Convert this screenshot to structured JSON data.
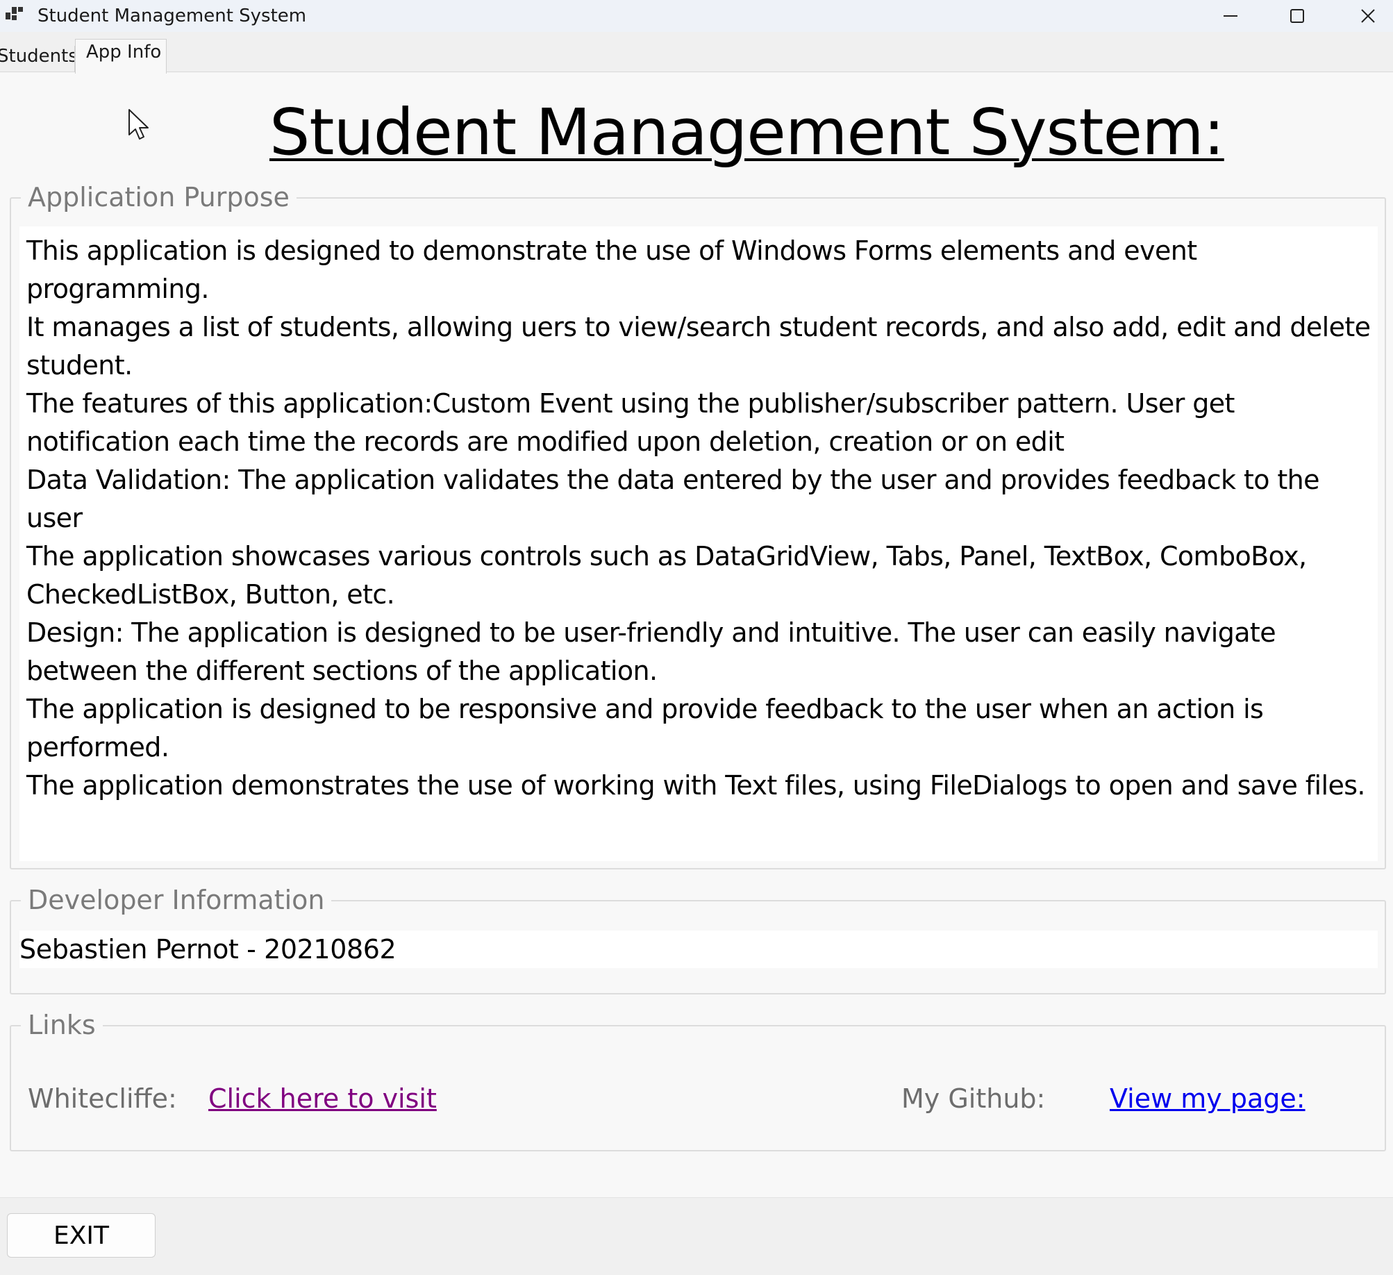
{
  "window": {
    "title": "Student Management System",
    "controls": {
      "minimize_icon": "minimize-icon",
      "maximize_icon": "maximize-icon",
      "close_icon": "close-icon"
    }
  },
  "tabs": [
    {
      "label": "Students",
      "selected": false
    },
    {
      "label": "App Info",
      "selected": true
    }
  ],
  "page": {
    "title": "Student Management System:"
  },
  "purpose": {
    "legend": "Application Purpose",
    "lines": [
      "This application is designed to demonstrate the use of Windows Forms elements and event",
      "programming.",
      "It manages a list of students, allowing uers to view/search student records, and also add, edit and delete",
      "student.",
      "The features of this application:Custom Event using the publisher/subscriber pattern. User get",
      "notification each time the records are modified upon deletion, creation or on edit",
      "Data Validation: The application validates the data entered by the user and provides feedback to the",
      "user",
      "The application showcases various controls such as DataGridView, Tabs, Panel, TextBox, ComboBox,",
      "CheckedListBox, Button, etc.",
      "Design: The application is designed to be user-friendly and intuitive. The user can easily navigate",
      "between the different sections of the application.",
      "The application is designed to be responsive and provide feedback to the user when an action is",
      "performed.",
      "The application demonstrates the use of working with Text files, using FileDialogs to open and save files."
    ]
  },
  "developer": {
    "legend": "Developer Information",
    "value": "Sebastien Pernot - 20210862"
  },
  "links": {
    "legend": "Links",
    "whitecliffe_label": "Whitecliffe:",
    "whitecliffe_link": "Click here to visit",
    "github_label": "My Github:",
    "github_link": "View my page:"
  },
  "exit_button": "EXIT",
  "colors": {
    "visited_link": "#800080",
    "link": "#0000ee",
    "legend_text": "#7a7a7a"
  }
}
